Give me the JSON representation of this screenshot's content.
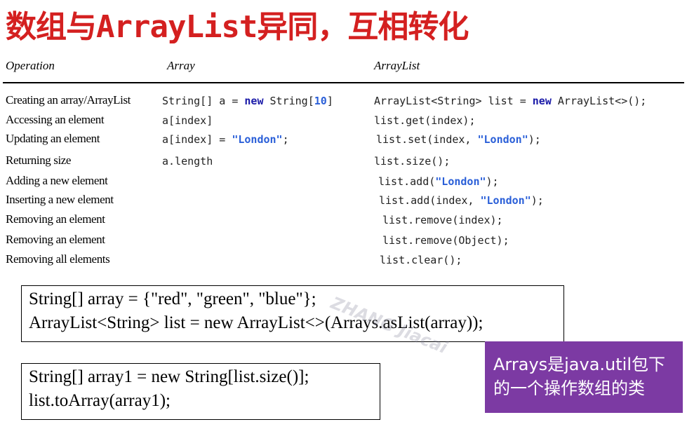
{
  "title": "数组与ArrayList异同，互相转化",
  "table": {
    "headers": {
      "operation": "Operation",
      "array": "Array",
      "arraylist": "ArrayList"
    },
    "rows": [
      {
        "op": "Creating an array/ArrayList",
        "array": [
          {
            "t": "String[] a = "
          },
          {
            "t": "new",
            "c": "kw"
          },
          {
            "t": " String["
          },
          {
            "t": "10",
            "c": "num"
          },
          {
            "t": "]"
          }
        ],
        "list": [
          {
            "t": "ArrayList<String> list = "
          },
          {
            "t": "new",
            "c": "kw"
          },
          {
            "t": " ArrayList<>();"
          }
        ]
      },
      {
        "op": "Accessing an element",
        "array": [
          {
            "t": "a[index]"
          }
        ],
        "list": [
          {
            "t": "list.get(index);"
          }
        ]
      },
      {
        "op": "Updating an element",
        "array": [
          {
            "t": "a[index] = "
          },
          {
            "t": "\"London\"",
            "c": "str"
          },
          {
            "t": ";"
          }
        ],
        "list": [
          {
            "t": "list.set(index, "
          },
          {
            "t": "\"London\"",
            "c": "str"
          },
          {
            "t": ");"
          }
        ]
      },
      {
        "op": "Returning size",
        "array": [
          {
            "t": "a.length"
          }
        ],
        "list": [
          {
            "t": "list.size();"
          }
        ]
      },
      {
        "op": "Adding a new element",
        "array": [],
        "list": [
          {
            "t": "list.add("
          },
          {
            "t": "\"London\"",
            "c": "str"
          },
          {
            "t": ");"
          }
        ]
      },
      {
        "op": "Inserting a new element",
        "array": [],
        "list": [
          {
            "t": "list.add(index, "
          },
          {
            "t": "\"London\"",
            "c": "str"
          },
          {
            "t": ");"
          }
        ]
      },
      {
        "op": "Removing an element",
        "array": [],
        "list": [
          {
            "t": "list.remove(index);"
          }
        ]
      },
      {
        "op": "Removing an element",
        "array": [],
        "list": [
          {
            "t": "list.remove(Object);"
          }
        ]
      },
      {
        "op": "Removing all elements",
        "array": [],
        "list": [
          {
            "t": "list.clear();"
          }
        ]
      }
    ]
  },
  "box1": {
    "line1": "String[] array = {\"red\", \"green\", \"blue\"};",
    "line2": "ArrayList<String> list = new ArrayList<>(Arrays.asList(array));"
  },
  "box2": {
    "line1": "String[] array1 = new String[list.size()];",
    "line2": "list.toArray(array1);"
  },
  "note": {
    "line1": "Arrays是java.util包下",
    "line2": "的一个操作数组的类"
  },
  "watermark": "ZHANG Jiacai"
}
